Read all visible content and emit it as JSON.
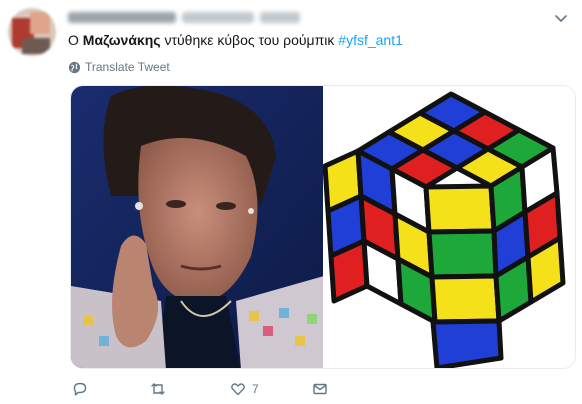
{
  "tweet": {
    "text_prefix": "Ο ",
    "text_bold": "Μαζωνάκης",
    "text_middle": " ντύθηκε κύβος του ρούμπικ ",
    "hashtag": "#yfsf_ant1",
    "translate_label": "Translate Tweet"
  },
  "actions": {
    "reply_count": "",
    "retweet_count": "",
    "like_count": "7",
    "message_count": ""
  },
  "media": {
    "left_icon": "person-photo",
    "right_icon": "rubiks-cube-illustration"
  },
  "colors": {
    "link": "#1da1f2",
    "muted": "#657786",
    "text": "#14171a",
    "cube_red": "#e02020",
    "cube_blue": "#1f3fd6",
    "cube_green": "#1fa83a",
    "cube_yellow": "#f5e11a",
    "cube_white": "#ffffff"
  }
}
